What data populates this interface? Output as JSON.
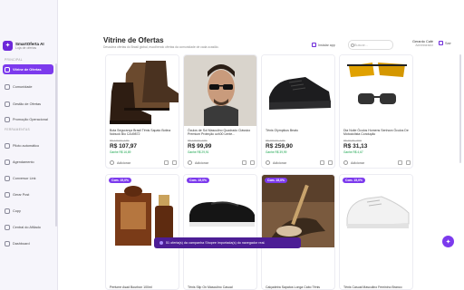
{
  "brand": {
    "name": "SmartOferta AI",
    "subtitle": "Loja de ofertas",
    "logo_icon": "spark-icon"
  },
  "sidebar": {
    "section_main": "PRINCIPAL",
    "section_tools": "FERRAMENTAS",
    "items": [
      {
        "label": "Vitrine de Ofertas",
        "active": true
      },
      {
        "label": "Comunidade"
      },
      {
        "label": "Gestão de Ofertas"
      },
      {
        "label": "Promoção Operacional"
      },
      {
        "label": "Piloto automático"
      },
      {
        "label": "Agendamento"
      },
      {
        "label": "Conversor Link"
      },
      {
        "label": "Gerar Post"
      },
      {
        "label": "Copy"
      },
      {
        "label": "Central do Afiliado"
      },
      {
        "label": "Dashboard"
      }
    ]
  },
  "header": {
    "title": "Vitrine de Ofertas",
    "description": "Descubra ofertas do Brasil global, escolhendo ofertas da comunidade de cada ocasião.",
    "install_label": "Instalar app",
    "search_placeholder": "Buscar...",
    "user_name": "Gerardo Café",
    "user_role": "Administrador",
    "logout_label": "Sair"
  },
  "products": [
    {
      "badge": "",
      "title": "Bota Segurança Brasil Tênis Sapato Botina Nobuck Bio CA49872",
      "old_price": "R$ 129,90 -17%",
      "price": "R$ 107,97",
      "savings": "Ganhe R$ 16,89",
      "add_label": "Adicionar"
    },
    {
      "badge": "",
      "title": "Óculos de Sol Masculino Quadrado Clássico Premium Proteção uv400 Lente...",
      "old_price": "R$ 129,90 -23%",
      "price": "R$ 99,99",
      "savings": "Ganhe R$ 29,91",
      "add_label": "Adicionar"
    },
    {
      "badge": "",
      "title": "Tênis Olympikus Beato",
      "old_price": "R$ 299,90 -14%",
      "price": "R$ 259,90",
      "savings": "Ganhe R$ 39,99",
      "add_label": "Adicionar"
    },
    {
      "badge": "",
      "title": "Dia Noite Óculos Homens Senhora Óculos De Motociclista Condução",
      "old_price": "R$ 39,00 -20%",
      "price": "R$ 31,13",
      "savings": "Ganhe R$ 4,67",
      "add_label": "Adicionar"
    },
    {
      "badge": "Com. 15,0%",
      "title": "Perfume Asad Bourbon 100ml",
      "old_price": "",
      "price": "",
      "savings": "",
      "add_label": ""
    },
    {
      "badge": "Com. 15,0%",
      "title": "Tênis Slip On Masculino Casual",
      "old_price": "",
      "price": "",
      "savings": "",
      "add_label": ""
    },
    {
      "badge": "Com. 15,0%",
      "title": "Calçadeira Sapatos Longa Cabo Tênis",
      "old_price": "",
      "price": "",
      "savings": "",
      "add_label": ""
    },
    {
      "badge": "Com. 15,0%",
      "title": "Tênis Casual Masculino Feminino Branco",
      "old_price": "",
      "price": "",
      "savings": "",
      "add_label": ""
    }
  ],
  "toast": {
    "text": "51 oferta(s) da campanha Shopee importada(s) do navegador real."
  },
  "colors": {
    "accent": "#7c3aed",
    "accent_dark": "#4c1d95",
    "success": "#16a34a"
  }
}
